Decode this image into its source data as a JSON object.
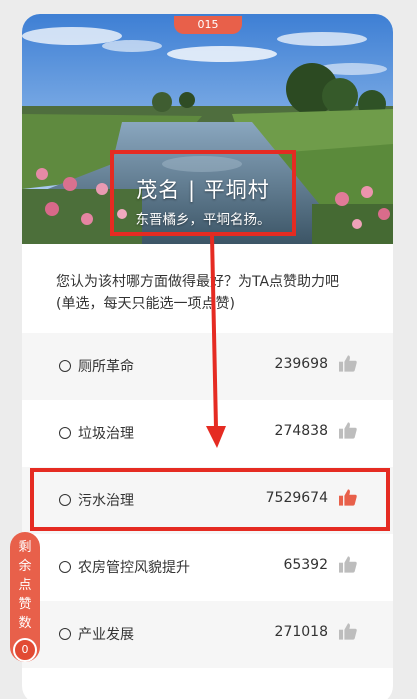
{
  "badge": {
    "number": "015"
  },
  "village": {
    "title": "茂名 | 平垌村",
    "subtitle": "东晋橘乡，平垌名扬。"
  },
  "question": {
    "line1": "您认为该村哪方面做得最好？为TA点赞助力吧",
    "line2": "(单选，每天只能选一项点赞)"
  },
  "options": [
    {
      "label": "厕所革命",
      "count": "239698",
      "liked": false
    },
    {
      "label": "垃圾治理",
      "count": "274838",
      "liked": false
    },
    {
      "label": "污水治理",
      "count": "7529674",
      "liked": true
    },
    {
      "label": "农房管控风貌提升",
      "count": "65392",
      "liked": false
    },
    {
      "label": "产业发展",
      "count": "271018",
      "liked": false
    }
  ],
  "side_panel": {
    "label": "剩余点赞数",
    "remaining": "0"
  },
  "colors": {
    "accent": "#e8604a",
    "highlight": "#e52b22",
    "thumb_inactive": "#bdbdbd",
    "thumb_active": "#e8604a"
  }
}
